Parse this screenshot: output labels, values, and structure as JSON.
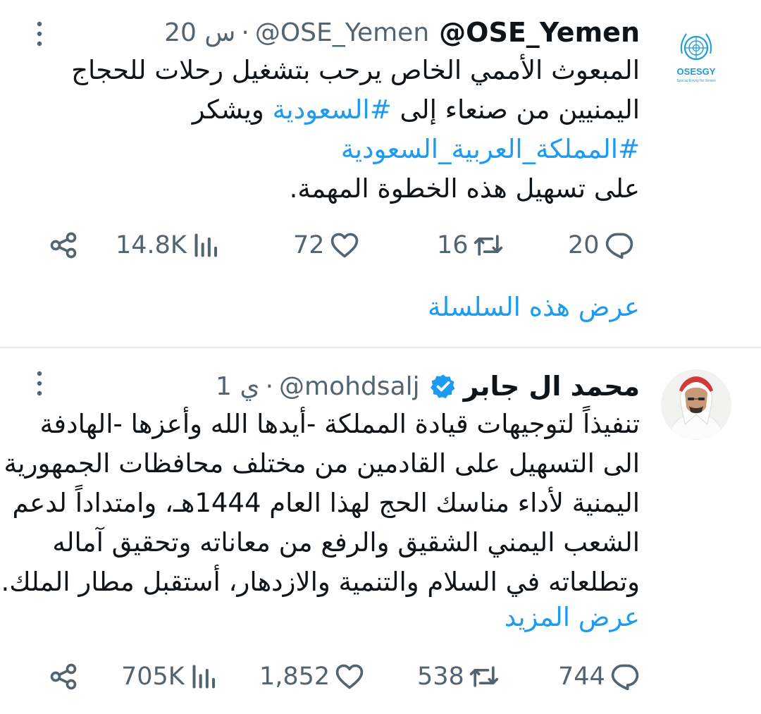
{
  "tweet1": {
    "display_name": "@OSE_Yemen",
    "handle": "@OSE_Yemen",
    "separator": "·",
    "time": "20 س",
    "avatar_text": "OSESGY",
    "avatar_subtext": "Special Envoy for Yemen",
    "text": {
      "line1": "المبعوث الأممي الخاص يرحب بتشغيل رحلات للحجاج",
      "line2_a": "اليمنيين من صنعاء إلى ",
      "line2_hashtag": "#السعودية",
      "line2_b": " ويشكر",
      "line3_hashtag": "#المملكة_العربية_السعودية",
      "line4": "على تسهيل هذه الخطوة المهمة."
    },
    "stats": {
      "replies": "20",
      "retweets": "16",
      "likes": "72",
      "views": "14.8K"
    },
    "show_thread": "عرض هذه السلسلة"
  },
  "tweet2": {
    "display_name": "محمد ال جابر",
    "verified": true,
    "handle": "@mohdsalj",
    "separator": "·",
    "time": "1 ي",
    "text": {
      "line1": "تنفيذاً لتوجيهات قيادة المملكة -أيدها الله وأعزها -الهادفة",
      "line2": "الى التسهيل على القادمين من مختلف محافظات الجمهورية",
      "line3": "اليمنية لأداء مناسك الحج لهذا العام 1444هـ، وامتداداً لدعم",
      "line4": "الشعب اليمني الشقيق والرفع من معاناته وتحقيق آماله",
      "line5": "وتطلعاته في السلام والتنمية والازدهار، أستقبل مطار الملك..."
    },
    "show_more": "عرض المزيد",
    "stats": {
      "replies": "744",
      "retweets": "538",
      "likes": "1,852",
      "views": "705K"
    }
  },
  "colors": {
    "accent": "#1d9bf0",
    "muted": "#536471",
    "text": "#0f1419",
    "divider": "#e7e9ea"
  },
  "icons": [
    "more-vertical-icon",
    "reply-icon",
    "retweet-icon",
    "like-icon",
    "views-icon",
    "share-icon",
    "verified-badge-icon"
  ]
}
